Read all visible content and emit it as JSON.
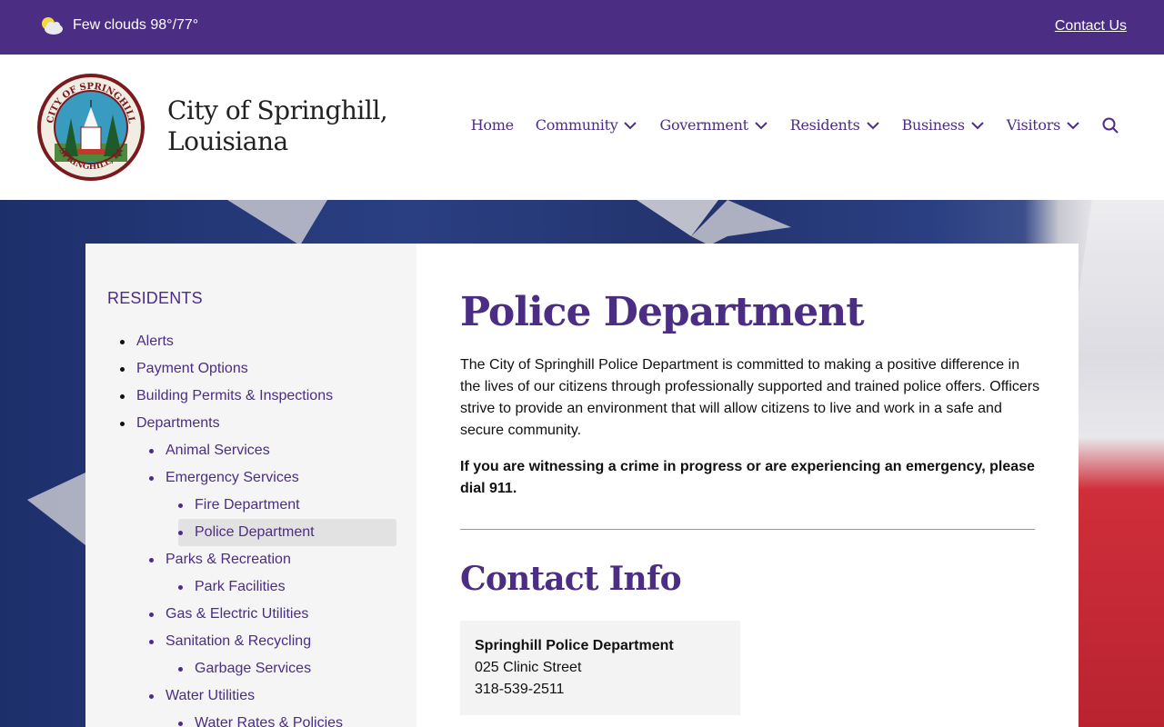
{
  "topbar": {
    "weather_text": "Few clouds 98°/77°",
    "contact_label": "Contact Us"
  },
  "header": {
    "title_line1": "City of Springhill,",
    "title_line2": "Louisiana",
    "seal_text_top": "CITY OF SPRINGHILL",
    "seal_text_bottom": "SPRINGHILL, LA"
  },
  "nav": {
    "items": [
      {
        "label": "Home",
        "dropdown": false
      },
      {
        "label": "Community",
        "dropdown": true
      },
      {
        "label": "Government",
        "dropdown": true
      },
      {
        "label": "Residents",
        "dropdown": true
      },
      {
        "label": "Business",
        "dropdown": true
      },
      {
        "label": "Visitors",
        "dropdown": true
      }
    ]
  },
  "sidebar": {
    "title": "RESIDENTS",
    "items": [
      {
        "label": "Alerts",
        "level": 1
      },
      {
        "label": "Payment Options",
        "level": 1
      },
      {
        "label": "Building Permits & Inspections",
        "level": 1
      },
      {
        "label": "Departments",
        "level": 1
      },
      {
        "label": "Animal Services",
        "level": 2
      },
      {
        "label": "Emergency Services",
        "level": 2
      },
      {
        "label": "Fire Department",
        "level": 3
      },
      {
        "label": "Police Department",
        "level": 3,
        "active": true
      },
      {
        "label": "Parks & Recreation",
        "level": 2
      },
      {
        "label": "Park Facilities",
        "level": 3
      },
      {
        "label": "Gas & Electric Utilities",
        "level": 2
      },
      {
        "label": "Sanitation & Recycling",
        "level": 2
      },
      {
        "label": "Garbage Services",
        "level": 3
      },
      {
        "label": "Water Utilities",
        "level": 2
      },
      {
        "label": "Water Rates & Policies",
        "level": 3
      }
    ]
  },
  "main": {
    "title": "Police Department",
    "intro": "The City of Springhill Police Department is committed to making a positive difference in the lives of our citizens through professionally supported and trained police offers. Officers strive to provide an environment that will allow citizens to live and work in a safe and secure community.",
    "emergency": "If you are witnessing a crime in progress or are experiencing an emergency, please dial 911.",
    "contact_title": "Contact Info",
    "contact": {
      "name": "Springhill Police Department",
      "address": "025 Clinic Street",
      "phone": "318-539-2511"
    }
  },
  "colors": {
    "brand_purple": "#4c2d84",
    "sidebar_bg": "#f5f5f5",
    "active_item_bg": "#e2e2e2"
  },
  "icons": [
    "weather-cloud-sun-icon",
    "chevron-down-icon",
    "search-icon",
    "city-seal-logo"
  ]
}
